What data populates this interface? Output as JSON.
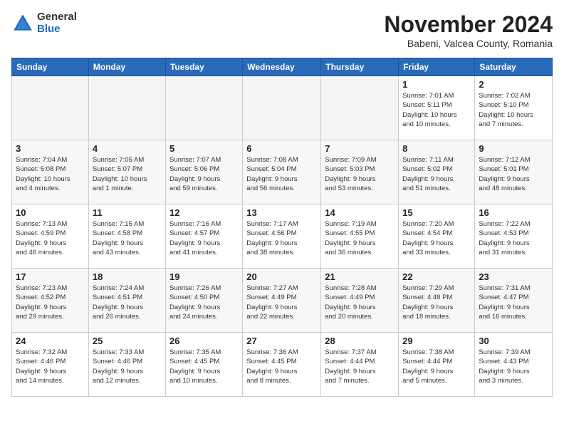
{
  "header": {
    "logo_general": "General",
    "logo_blue": "Blue",
    "month_title": "November 2024",
    "location": "Babeni, Valcea County, Romania"
  },
  "days_of_week": [
    "Sunday",
    "Monday",
    "Tuesday",
    "Wednesday",
    "Thursday",
    "Friday",
    "Saturday"
  ],
  "weeks": [
    [
      {
        "day": "",
        "info": "",
        "empty": true
      },
      {
        "day": "",
        "info": "",
        "empty": true
      },
      {
        "day": "",
        "info": "",
        "empty": true
      },
      {
        "day": "",
        "info": "",
        "empty": true
      },
      {
        "day": "",
        "info": "",
        "empty": true
      },
      {
        "day": "1",
        "info": "Sunrise: 7:01 AM\nSunset: 5:11 PM\nDaylight: 10 hours\nand 10 minutes."
      },
      {
        "day": "2",
        "info": "Sunrise: 7:02 AM\nSunset: 5:10 PM\nDaylight: 10 hours\nand 7 minutes."
      }
    ],
    [
      {
        "day": "3",
        "info": "Sunrise: 7:04 AM\nSunset: 5:08 PM\nDaylight: 10 hours\nand 4 minutes."
      },
      {
        "day": "4",
        "info": "Sunrise: 7:05 AM\nSunset: 5:07 PM\nDaylight: 10 hours\nand 1 minute."
      },
      {
        "day": "5",
        "info": "Sunrise: 7:07 AM\nSunset: 5:06 PM\nDaylight: 9 hours\nand 59 minutes."
      },
      {
        "day": "6",
        "info": "Sunrise: 7:08 AM\nSunset: 5:04 PM\nDaylight: 9 hours\nand 56 minutes."
      },
      {
        "day": "7",
        "info": "Sunrise: 7:09 AM\nSunset: 5:03 PM\nDaylight: 9 hours\nand 53 minutes."
      },
      {
        "day": "8",
        "info": "Sunrise: 7:11 AM\nSunset: 5:02 PM\nDaylight: 9 hours\nand 51 minutes."
      },
      {
        "day": "9",
        "info": "Sunrise: 7:12 AM\nSunset: 5:01 PM\nDaylight: 9 hours\nand 48 minutes."
      }
    ],
    [
      {
        "day": "10",
        "info": "Sunrise: 7:13 AM\nSunset: 4:59 PM\nDaylight: 9 hours\nand 46 minutes."
      },
      {
        "day": "11",
        "info": "Sunrise: 7:15 AM\nSunset: 4:58 PM\nDaylight: 9 hours\nand 43 minutes."
      },
      {
        "day": "12",
        "info": "Sunrise: 7:16 AM\nSunset: 4:57 PM\nDaylight: 9 hours\nand 41 minutes."
      },
      {
        "day": "13",
        "info": "Sunrise: 7:17 AM\nSunset: 4:56 PM\nDaylight: 9 hours\nand 38 minutes."
      },
      {
        "day": "14",
        "info": "Sunrise: 7:19 AM\nSunset: 4:55 PM\nDaylight: 9 hours\nand 36 minutes."
      },
      {
        "day": "15",
        "info": "Sunrise: 7:20 AM\nSunset: 4:54 PM\nDaylight: 9 hours\nand 33 minutes."
      },
      {
        "day": "16",
        "info": "Sunrise: 7:22 AM\nSunset: 4:53 PM\nDaylight: 9 hours\nand 31 minutes."
      }
    ],
    [
      {
        "day": "17",
        "info": "Sunrise: 7:23 AM\nSunset: 4:52 PM\nDaylight: 9 hours\nand 29 minutes."
      },
      {
        "day": "18",
        "info": "Sunrise: 7:24 AM\nSunset: 4:51 PM\nDaylight: 9 hours\nand 26 minutes."
      },
      {
        "day": "19",
        "info": "Sunrise: 7:26 AM\nSunset: 4:50 PM\nDaylight: 9 hours\nand 24 minutes."
      },
      {
        "day": "20",
        "info": "Sunrise: 7:27 AM\nSunset: 4:49 PM\nDaylight: 9 hours\nand 22 minutes."
      },
      {
        "day": "21",
        "info": "Sunrise: 7:28 AM\nSunset: 4:49 PM\nDaylight: 9 hours\nand 20 minutes."
      },
      {
        "day": "22",
        "info": "Sunrise: 7:29 AM\nSunset: 4:48 PM\nDaylight: 9 hours\nand 18 minutes."
      },
      {
        "day": "23",
        "info": "Sunrise: 7:31 AM\nSunset: 4:47 PM\nDaylight: 9 hours\nand 16 minutes."
      }
    ],
    [
      {
        "day": "24",
        "info": "Sunrise: 7:32 AM\nSunset: 4:46 PM\nDaylight: 9 hours\nand 14 minutes."
      },
      {
        "day": "25",
        "info": "Sunrise: 7:33 AM\nSunset: 4:46 PM\nDaylight: 9 hours\nand 12 minutes."
      },
      {
        "day": "26",
        "info": "Sunrise: 7:35 AM\nSunset: 4:45 PM\nDaylight: 9 hours\nand 10 minutes."
      },
      {
        "day": "27",
        "info": "Sunrise: 7:36 AM\nSunset: 4:45 PM\nDaylight: 9 hours\nand 8 minutes."
      },
      {
        "day": "28",
        "info": "Sunrise: 7:37 AM\nSunset: 4:44 PM\nDaylight: 9 hours\nand 7 minutes."
      },
      {
        "day": "29",
        "info": "Sunrise: 7:38 AM\nSunset: 4:44 PM\nDaylight: 9 hours\nand 5 minutes."
      },
      {
        "day": "30",
        "info": "Sunrise: 7:39 AM\nSunset: 4:43 PM\nDaylight: 9 hours\nand 3 minutes."
      }
    ]
  ]
}
